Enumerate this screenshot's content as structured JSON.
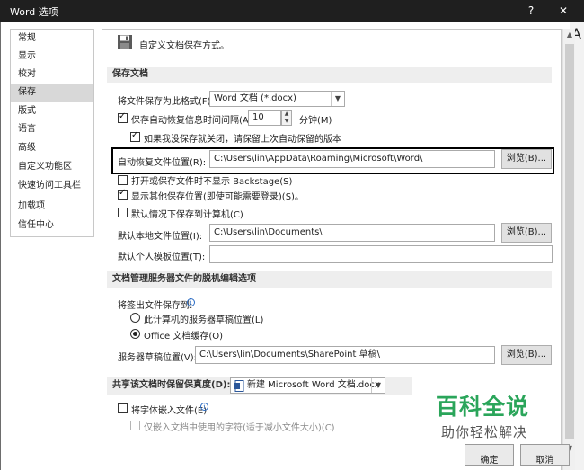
{
  "window": {
    "title": "Word 选项",
    "help_btn": "?",
    "close_btn": "✕"
  },
  "sidebar": {
    "items": [
      {
        "label": "常规"
      },
      {
        "label": "显示"
      },
      {
        "label": "校对"
      },
      {
        "label": "保存"
      },
      {
        "label": "版式"
      },
      {
        "label": "语言"
      },
      {
        "label": "高级"
      },
      {
        "label": "自定义功能区"
      },
      {
        "label": "快速访问工具栏"
      },
      {
        "label": "加载项"
      },
      {
        "label": "信任中心"
      }
    ],
    "selected": "保存"
  },
  "header": {
    "text": "自定义文档保存方式。",
    "icon": "save-floppy-icon"
  },
  "save_docs": {
    "section_title": "保存文档",
    "format_label": "将文件保存为此格式(F):",
    "format_value": "Word 文档 (*.docx)",
    "autosave_label": "保存自动恢复信息时间间隔(A)",
    "autosave_checked": true,
    "autosave_minutes": "10",
    "minutes_label": "分钟(M)",
    "keep_last_label": "如果我没保存就关闭，请保留上次自动保留的版本",
    "keep_last_checked": true,
    "autorecover_location_label": "自动恢复文件位置(R):",
    "autorecover_location_value": "C:\\Users\\lin\\AppData\\Roaming\\Microsoft\\Word\\",
    "browse_label": "浏览(B)...",
    "no_backstage_label": "打开或保存文件时不显示 Backstage(S)",
    "no_backstage_checked": false,
    "show_more_label": "显示其他保存位置(即使可能需要登录)(S)。",
    "show_more_checked": true,
    "default_computer_label": "默认情况下保存到计算机(C)",
    "default_computer_checked": false,
    "default_local_label": "默认本地文件位置(I):",
    "default_local_value": "C:\\Users\\lin\\Documents\\",
    "browse2_label": "浏览(B)...",
    "default_template_label": "默认个人模板位置(T):",
    "default_template_value": ""
  },
  "offline_editing": {
    "section_title": "文档管理服务器文件的脱机编辑选项",
    "checkout_label": "将签出文件保存到:",
    "option_server_label": "此计算机的服务器草稿位置(L)",
    "option_server_checked": false,
    "option_cache_label": "Office 文档缓存(O)",
    "option_cache_checked": true,
    "drafts_label": "服务器草稿位置(V):",
    "drafts_value": "C:\\Users\\lin\\Documents\\SharePoint 草稿\\",
    "browse3_label": "浏览(B)..."
  },
  "fidelity": {
    "section_title": "共享该文档时保留保真度(D):",
    "doc_value": "新建 Microsoft Word 文档.docx",
    "embed_fonts_label": "将字体嵌入文件(E)",
    "embed_fonts_checked": false,
    "embed_used_label": "仅嵌入文档中使用的字符(适于减小文件大小)(C)",
    "embed_used_checked": false
  },
  "footer": {
    "ok_label": "确定",
    "cancel_label": "取消"
  },
  "watermark": {
    "title": "百科全说",
    "subtitle": "助你轻松解决"
  },
  "edge_letter": "A"
}
